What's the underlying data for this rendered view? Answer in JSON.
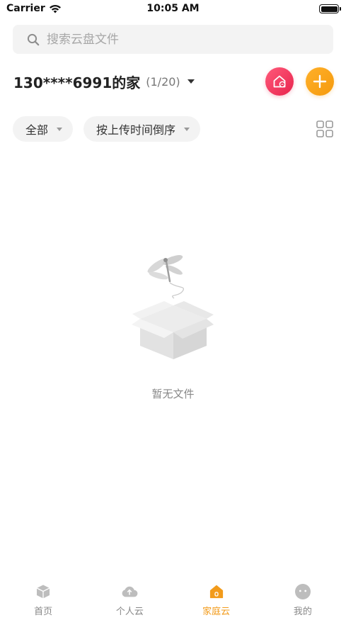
{
  "status_bar": {
    "carrier": "Carrier",
    "time": "10:05 AM"
  },
  "search": {
    "placeholder": "搜索云盘文件"
  },
  "family": {
    "name": "130****6991的家",
    "member_count": "(1/20)"
  },
  "filters": {
    "type_label": "全部",
    "sort_label": "按上传时间倒序"
  },
  "empty_state": {
    "text": "暂无文件"
  },
  "tabs": [
    {
      "label": "首页",
      "icon": "cube-icon"
    },
    {
      "label": "个人云",
      "icon": "cloud-upload-icon"
    },
    {
      "label": "家庭云",
      "icon": "family-house-icon",
      "active": true
    },
    {
      "label": "我的",
      "icon": "face-icon"
    }
  ],
  "colors": {
    "accent": "#f29b1b",
    "home_button": "#e8244d",
    "add_button": "#f59a0c"
  }
}
